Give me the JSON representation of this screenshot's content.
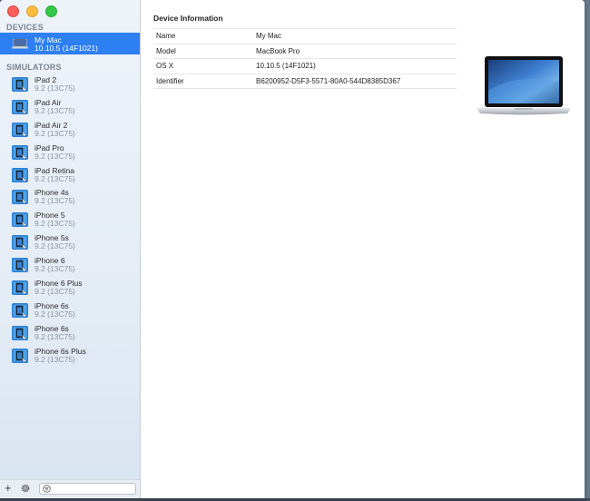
{
  "sidebar": {
    "devices_header": "DEVICES",
    "selected_device": {
      "name": "My Mac",
      "version": "10.10.5 (14F1021)"
    },
    "simulators_header": "SIMULATORS",
    "simulators": [
      {
        "name": "iPad 2",
        "version": "9.2 (13C75)"
      },
      {
        "name": "iPad Air",
        "version": "9.2 (13C75)"
      },
      {
        "name": "iPad Air 2",
        "version": "9.2 (13C75)"
      },
      {
        "name": "iPad Pro",
        "version": "9.2 (13C75)"
      },
      {
        "name": "iPad Retina",
        "version": "9.2 (13C75)"
      },
      {
        "name": "iPhone 4s",
        "version": "9.2 (13C75)"
      },
      {
        "name": "iPhone 5",
        "version": "9.2 (13C75)"
      },
      {
        "name": "iPhone 5s",
        "version": "9.2 (13C75)"
      },
      {
        "name": "iPhone 6",
        "version": "9.2 (13C75)"
      },
      {
        "name": "iPhone 6 Plus",
        "version": "9.2 (13C75)"
      },
      {
        "name": "iPhone 6s",
        "version": "9.2 (13C75)"
      },
      {
        "name": "iPhone 6s",
        "version": "9.2 (13C75)"
      },
      {
        "name": "iPhone 6s Plus",
        "version": "9.2 (13C75)"
      }
    ],
    "bottom": {
      "add_label": "+"
    }
  },
  "main": {
    "title": "Device Information",
    "rows": [
      {
        "key": "Name",
        "value": "My Mac"
      },
      {
        "key": "Model",
        "value": "MacBook Pro"
      },
      {
        "key": "OS X",
        "value": "10.10.5 (14F1021)"
      },
      {
        "key": "Identifier",
        "value": "B6200952-D5F3-5571-80A0-544D8385D367"
      }
    ]
  },
  "colors": {
    "selection": "#2d7ff2",
    "sidebar_bg": "#e4ecf5"
  }
}
